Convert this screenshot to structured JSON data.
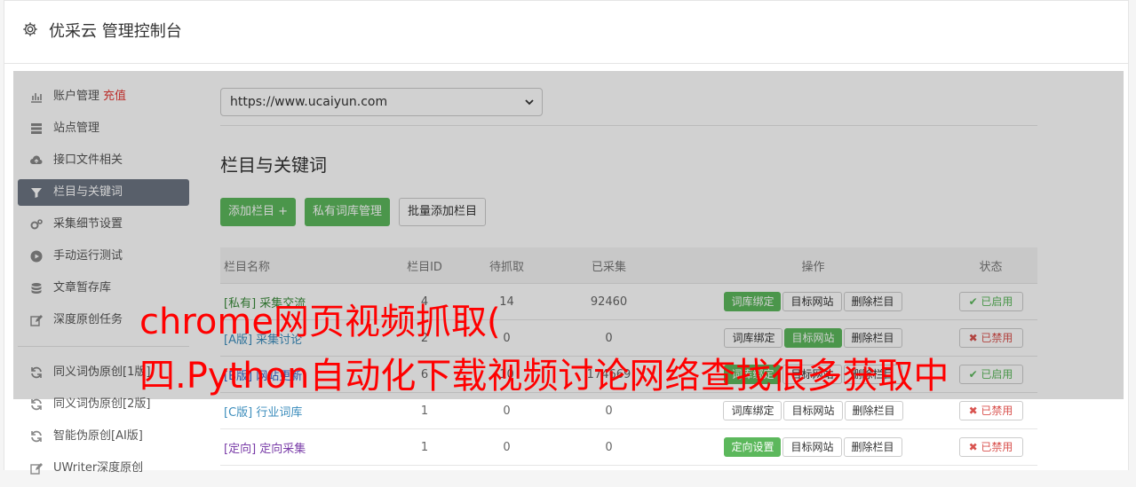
{
  "header": {
    "title": "优采云 管理控制台"
  },
  "sidebar": {
    "items": [
      {
        "label": "账户管理",
        "extra": "充值",
        "icon": "bar-chart-icon"
      },
      {
        "label": "站点管理",
        "icon": "server-icon"
      },
      {
        "label": "接口文件相关",
        "icon": "cloud-upload-icon"
      },
      {
        "label": "栏目与关键词",
        "icon": "filter-icon",
        "active": true
      },
      {
        "label": "采集细节设置",
        "icon": "gears-icon"
      },
      {
        "label": "手动运行测试",
        "icon": "play-circle-icon"
      },
      {
        "label": "文章暂存库",
        "icon": "database-icon"
      },
      {
        "label": "深度原创任务",
        "icon": "edit-icon"
      }
    ],
    "items2": [
      {
        "label": "同义词伪原创[1版]",
        "icon": "refresh-icon"
      },
      {
        "label": "同义词伪原创[2版]",
        "icon": "refresh-icon"
      },
      {
        "label": "智能伪原创[AI版]",
        "icon": "refresh-icon"
      },
      {
        "label": "UWriter深度原创",
        "icon": "edit-icon"
      }
    ]
  },
  "main": {
    "site_select": "https://www.ucaiyun.com",
    "section_title": "栏目与关键词",
    "buttons": {
      "add": "添加栏目 +",
      "private_lib": "私有词库管理",
      "batch_add": "批量添加栏目"
    },
    "table": {
      "headers": [
        "栏目名称",
        "栏目ID",
        "待抓取",
        "已采集",
        "操作",
        "状态"
      ],
      "rows": [
        {
          "name": "[私有] 采集交流",
          "id": "4",
          "pending": "14",
          "collected": "92460",
          "op1": "词库绑定",
          "op2": "目标网站",
          "op3": "删除栏目",
          "status": "✔ 已启用"
        },
        {
          "name": "[A版] 采集讨论",
          "id": "2",
          "pending": "0",
          "collected": "0",
          "op1": "词库绑定",
          "op2": "目标网站",
          "op3": "删除栏目",
          "status": "✖ 已禁用"
        },
        {
          "name": "[B版] 网站更新",
          "id": "6",
          "pending": "10",
          "collected": "174669",
          "op1": "词库绑定",
          "op2": "目标网站",
          "op3": "删除栏目",
          "status": "✔ 已启用"
        },
        {
          "name": "[C版] 行业词库",
          "id": "1",
          "pending": "0",
          "collected": "0",
          "op1": "词库绑定",
          "op2": "目标网站",
          "op3": "删除栏目",
          "status": "✖ 已禁用"
        },
        {
          "name": "[定向] 定向采集",
          "id": "1",
          "pending": "0",
          "collected": "0",
          "op1": "定向设置",
          "op2": "目标网站",
          "op3": "删除栏目",
          "status": "✖ 已禁用"
        }
      ]
    }
  },
  "overlay": {
    "line1": "chrome网页视频抓取(",
    "line2": "四.Python自动化下载视频讨论网络查找很多获取中"
  }
}
